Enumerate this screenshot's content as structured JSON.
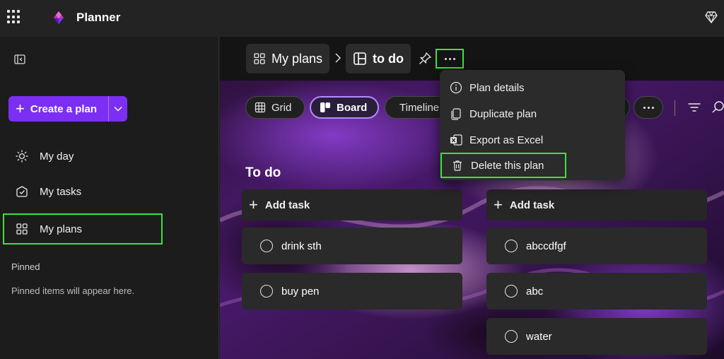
{
  "app": {
    "title": "Planner"
  },
  "sidebar": {
    "create_label": "Create a plan",
    "nav": [
      {
        "label": "My day"
      },
      {
        "label": "My tasks"
      },
      {
        "label": "My plans"
      }
    ],
    "pinned_title": "Pinned",
    "pinned_empty": "Pinned items will appear here."
  },
  "breadcrumb": {
    "parent": "My plans",
    "current": "to do"
  },
  "views": {
    "grid": "Grid",
    "board": "Board",
    "timeline": "Timeline"
  },
  "board": {
    "bucket_title": "To do",
    "add_task_label": "Add task",
    "column1": [
      "drink sth",
      "buy pen"
    ],
    "column2": [
      "abccdfgf",
      "abc",
      "water"
    ]
  },
  "menu": {
    "items": [
      "Plan details",
      "Duplicate plan",
      "Export as Excel",
      "Delete this plan"
    ]
  },
  "colors": {
    "accent": "#7b2ff2",
    "highlight": "#3ce23c",
    "board_active": "#b48aff"
  }
}
